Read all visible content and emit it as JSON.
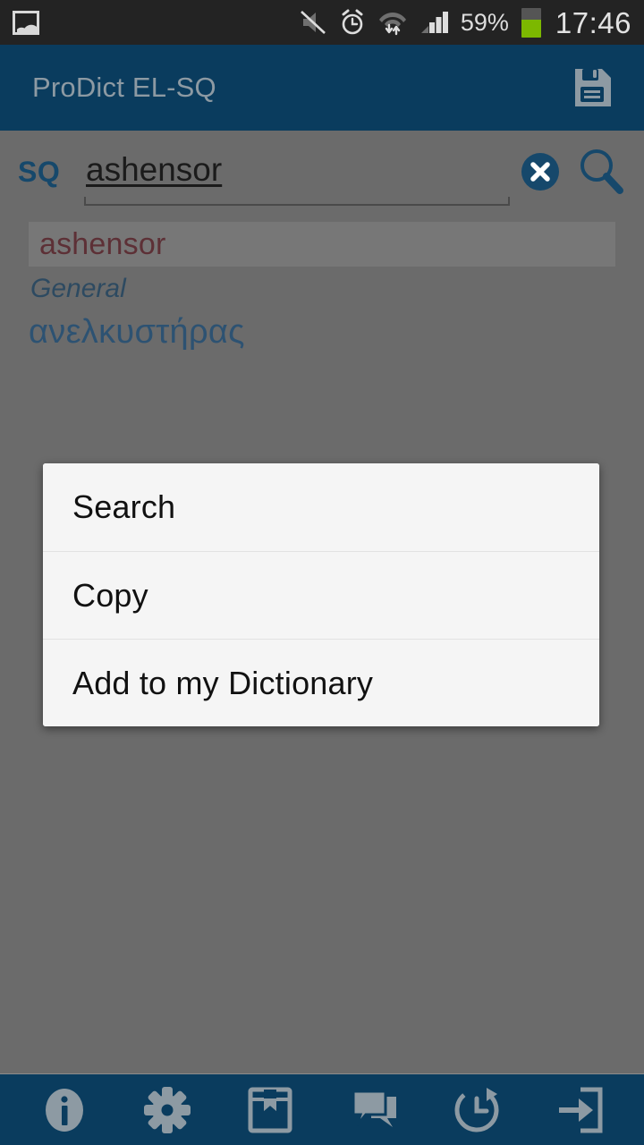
{
  "status_bar": {
    "notification_icon": "gallery-icon",
    "icons": [
      "mute-icon",
      "alarm-icon",
      "wifi-icon",
      "signal-icon"
    ],
    "battery_percent": "59%",
    "battery_level": 60,
    "time": "17:46"
  },
  "header": {
    "title": "ProDict EL-SQ",
    "save_icon": "save-icon",
    "background": "#0a3c5e",
    "title_color": "#8d9aa3"
  },
  "search": {
    "lang_label": "SQ",
    "value": "ashensor",
    "placeholder": "",
    "clear_icon": "clear-circle-icon",
    "search_icon": "search-icon",
    "accent": "#16486b"
  },
  "entry": {
    "headword": "ashensor",
    "category": "General",
    "translation": "ανελκυστήρας",
    "headword_color": "#5d3036",
    "translation_color": "#2d5272"
  },
  "context_menu": {
    "items": [
      {
        "label": "Search",
        "name": "menu-item-search"
      },
      {
        "label": "Copy",
        "name": "menu-item-copy"
      },
      {
        "label": "Add to my Dictionary",
        "name": "menu-item-add-to-dictionary"
      }
    ]
  },
  "bottom_toolbar": {
    "items": [
      {
        "name": "info-icon"
      },
      {
        "name": "settings-gear-icon"
      },
      {
        "name": "bookmark-book-icon"
      },
      {
        "name": "chat-bubbles-icon"
      },
      {
        "name": "history-icon"
      },
      {
        "name": "exit-icon"
      }
    ],
    "background": "#0a3c5e",
    "icon_color": "#8d9aa3"
  }
}
